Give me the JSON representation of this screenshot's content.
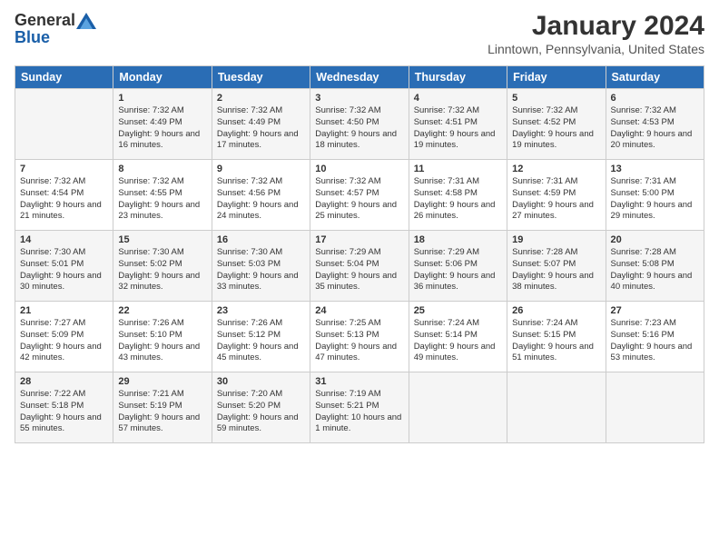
{
  "header": {
    "logo_general": "General",
    "logo_blue": "Blue",
    "month_title": "January 2024",
    "location": "Linntown, Pennsylvania, United States"
  },
  "days_of_week": [
    "Sunday",
    "Monday",
    "Tuesday",
    "Wednesday",
    "Thursday",
    "Friday",
    "Saturday"
  ],
  "weeks": [
    [
      {
        "day": "",
        "sunrise": "",
        "sunset": "",
        "daylight": ""
      },
      {
        "day": "1",
        "sunrise": "7:32 AM",
        "sunset": "4:49 PM",
        "daylight": "9 hours and 16 minutes."
      },
      {
        "day": "2",
        "sunrise": "7:32 AM",
        "sunset": "4:49 PM",
        "daylight": "9 hours and 17 minutes."
      },
      {
        "day": "3",
        "sunrise": "7:32 AM",
        "sunset": "4:50 PM",
        "daylight": "9 hours and 18 minutes."
      },
      {
        "day": "4",
        "sunrise": "7:32 AM",
        "sunset": "4:51 PM",
        "daylight": "9 hours and 19 minutes."
      },
      {
        "day": "5",
        "sunrise": "7:32 AM",
        "sunset": "4:52 PM",
        "daylight": "9 hours and 19 minutes."
      },
      {
        "day": "6",
        "sunrise": "7:32 AM",
        "sunset": "4:53 PM",
        "daylight": "9 hours and 20 minutes."
      }
    ],
    [
      {
        "day": "7",
        "sunrise": "7:32 AM",
        "sunset": "4:54 PM",
        "daylight": "9 hours and 21 minutes."
      },
      {
        "day": "8",
        "sunrise": "7:32 AM",
        "sunset": "4:55 PM",
        "daylight": "9 hours and 23 minutes."
      },
      {
        "day": "9",
        "sunrise": "7:32 AM",
        "sunset": "4:56 PM",
        "daylight": "9 hours and 24 minutes."
      },
      {
        "day": "10",
        "sunrise": "7:32 AM",
        "sunset": "4:57 PM",
        "daylight": "9 hours and 25 minutes."
      },
      {
        "day": "11",
        "sunrise": "7:31 AM",
        "sunset": "4:58 PM",
        "daylight": "9 hours and 26 minutes."
      },
      {
        "day": "12",
        "sunrise": "7:31 AM",
        "sunset": "4:59 PM",
        "daylight": "9 hours and 27 minutes."
      },
      {
        "day": "13",
        "sunrise": "7:31 AM",
        "sunset": "5:00 PM",
        "daylight": "9 hours and 29 minutes."
      }
    ],
    [
      {
        "day": "14",
        "sunrise": "7:30 AM",
        "sunset": "5:01 PM",
        "daylight": "9 hours and 30 minutes."
      },
      {
        "day": "15",
        "sunrise": "7:30 AM",
        "sunset": "5:02 PM",
        "daylight": "9 hours and 32 minutes."
      },
      {
        "day": "16",
        "sunrise": "7:30 AM",
        "sunset": "5:03 PM",
        "daylight": "9 hours and 33 minutes."
      },
      {
        "day": "17",
        "sunrise": "7:29 AM",
        "sunset": "5:04 PM",
        "daylight": "9 hours and 35 minutes."
      },
      {
        "day": "18",
        "sunrise": "7:29 AM",
        "sunset": "5:06 PM",
        "daylight": "9 hours and 36 minutes."
      },
      {
        "day": "19",
        "sunrise": "7:28 AM",
        "sunset": "5:07 PM",
        "daylight": "9 hours and 38 minutes."
      },
      {
        "day": "20",
        "sunrise": "7:28 AM",
        "sunset": "5:08 PM",
        "daylight": "9 hours and 40 minutes."
      }
    ],
    [
      {
        "day": "21",
        "sunrise": "7:27 AM",
        "sunset": "5:09 PM",
        "daylight": "9 hours and 42 minutes."
      },
      {
        "day": "22",
        "sunrise": "7:26 AM",
        "sunset": "5:10 PM",
        "daylight": "9 hours and 43 minutes."
      },
      {
        "day": "23",
        "sunrise": "7:26 AM",
        "sunset": "5:12 PM",
        "daylight": "9 hours and 45 minutes."
      },
      {
        "day": "24",
        "sunrise": "7:25 AM",
        "sunset": "5:13 PM",
        "daylight": "9 hours and 47 minutes."
      },
      {
        "day": "25",
        "sunrise": "7:24 AM",
        "sunset": "5:14 PM",
        "daylight": "9 hours and 49 minutes."
      },
      {
        "day": "26",
        "sunrise": "7:24 AM",
        "sunset": "5:15 PM",
        "daylight": "9 hours and 51 minutes."
      },
      {
        "day": "27",
        "sunrise": "7:23 AM",
        "sunset": "5:16 PM",
        "daylight": "9 hours and 53 minutes."
      }
    ],
    [
      {
        "day": "28",
        "sunrise": "7:22 AM",
        "sunset": "5:18 PM",
        "daylight": "9 hours and 55 minutes."
      },
      {
        "day": "29",
        "sunrise": "7:21 AM",
        "sunset": "5:19 PM",
        "daylight": "9 hours and 57 minutes."
      },
      {
        "day": "30",
        "sunrise": "7:20 AM",
        "sunset": "5:20 PM",
        "daylight": "9 hours and 59 minutes."
      },
      {
        "day": "31",
        "sunrise": "7:19 AM",
        "sunset": "5:21 PM",
        "daylight": "10 hours and 1 minute."
      },
      {
        "day": "",
        "sunrise": "",
        "sunset": "",
        "daylight": ""
      },
      {
        "day": "",
        "sunrise": "",
        "sunset": "",
        "daylight": ""
      },
      {
        "day": "",
        "sunrise": "",
        "sunset": "",
        "daylight": ""
      }
    ]
  ]
}
